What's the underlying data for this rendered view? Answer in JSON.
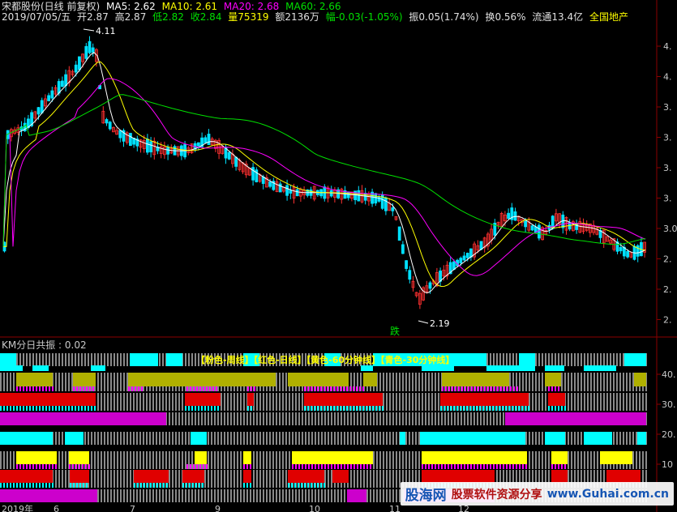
{
  "header": {
    "line1": {
      "stock": "宋都股份(日线 前复权)",
      "ma5": "MA5: 2.62",
      "ma10": "MA10: 2.61",
      "ma20": "MA20: 2.68",
      "ma60": "MA60: 2.66"
    },
    "line2": {
      "date": "2019/07/05/五",
      "open": "开2.87",
      "high": "高2.87",
      "low": "低2.82",
      "close": "收2.84",
      "volume": "量75319",
      "amount": "额2136万",
      "change": "幅-0.03(-1.05%)",
      "amplitude": "振0.05(1.74%)",
      "turnover": "换0.56%",
      "float_cap": "流通13.4亿",
      "sector": "全国地产"
    }
  },
  "price_axis": [
    "4.",
    "4.",
    "3.",
    "3.",
    "3.",
    "3.",
    "3.0",
    "2.",
    "2.",
    "2."
  ],
  "annotations": {
    "high_label": "4.11",
    "low_label": "2.19",
    "down_marker": "跌"
  },
  "indicator": {
    "title": "KM分日共振 : 0.02",
    "legend": "【粉色-周线】【红色-日线】【黄色-60分钟线】【青色-30分钟线】",
    "axis": [
      "40.",
      "30.",
      "20.",
      "10"
    ]
  },
  "date_axis": [
    "2019年",
    "6",
    "7",
    "9",
    "10",
    "11",
    "12"
  ],
  "colors": {
    "ma5": "#ffffff",
    "ma10": "#ffff00",
    "ma20": "#ff00ff",
    "ma60": "#00e000",
    "up": "#ff3030",
    "down": "#00e0ff",
    "pink": "#ff00ff",
    "red": "#e00000",
    "yellow": "#ffff00",
    "olive": "#b0b000",
    "cyan": "#00ffff",
    "magenta": "#cc00cc"
  },
  "watermark": {
    "logo": "股海网",
    "slogan": "股票软件资源分享",
    "url": "www.Guhai.com.cn"
  }
}
